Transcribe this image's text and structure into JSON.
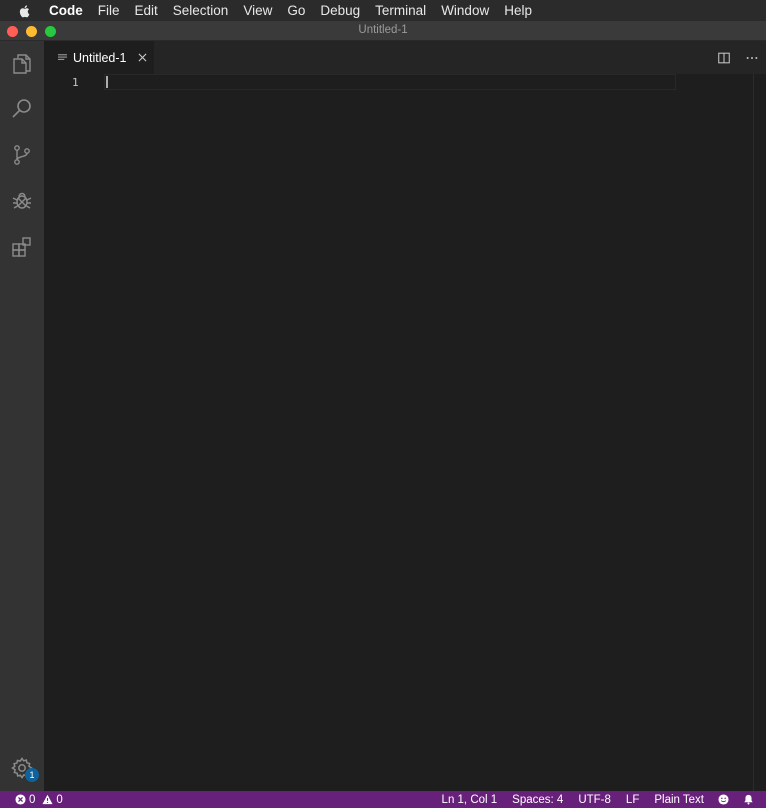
{
  "menubar": {
    "items": [
      "Code",
      "File",
      "Edit",
      "Selection",
      "View",
      "Go",
      "Debug",
      "Terminal",
      "Window",
      "Help"
    ]
  },
  "window": {
    "title": "Untitled-1"
  },
  "activitybar": {
    "items": [
      "files-icon",
      "search-icon",
      "source-control-icon",
      "debug-icon",
      "extensions-icon"
    ],
    "manage_badge": "1"
  },
  "tabs": [
    {
      "label": "Untitled-1",
      "active": true
    }
  ],
  "editor": {
    "line_numbers": [
      "1"
    ],
    "content": ""
  },
  "statusbar": {
    "errors": "0",
    "warnings": "0",
    "position": "Ln 1, Col 1",
    "indent": "Spaces: 4",
    "encoding": "UTF-8",
    "eol": "LF",
    "language": "Plain Text"
  },
  "colors": {
    "statusbar_bg": "#68217a",
    "activitybar_bg": "#333333",
    "editor_bg": "#1e1e1e",
    "badge_bg": "#0e639c"
  }
}
